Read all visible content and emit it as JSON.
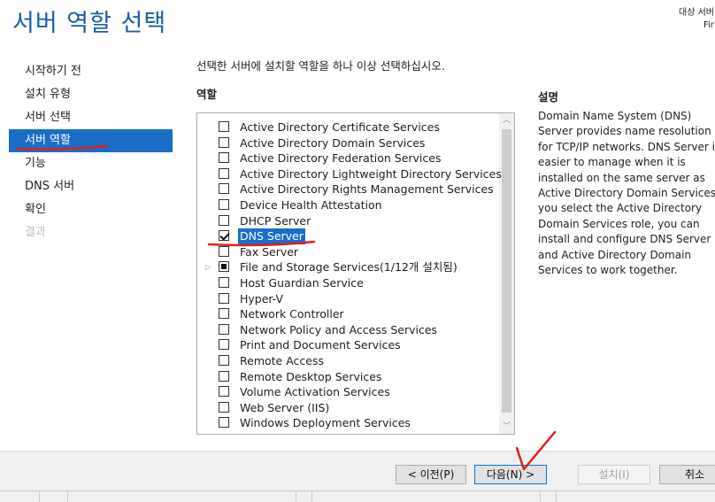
{
  "page": {
    "title": "서버 역할 선택",
    "target_server_label": "대상 서버",
    "target_server_name": "Fir"
  },
  "nav": {
    "items": [
      {
        "label": "시작하기 전",
        "state": "normal"
      },
      {
        "label": "설치 유형",
        "state": "normal"
      },
      {
        "label": "서버 선택",
        "state": "normal"
      },
      {
        "label": "서버 역할",
        "state": "active"
      },
      {
        "label": "기능",
        "state": "normal"
      },
      {
        "label": "DNS 서버",
        "state": "normal"
      },
      {
        "label": "확인",
        "state": "normal"
      },
      {
        "label": "결과",
        "state": "disabled"
      }
    ]
  },
  "main": {
    "instruction": "선택한 서버에 설치할 역할을 하나 이상 선택하십시오.",
    "roles_heading": "역할",
    "description_heading": "설명",
    "roles": [
      {
        "label": "Active Directory Certificate Services",
        "state": "unchecked",
        "selected": false,
        "expandable": false
      },
      {
        "label": "Active Directory Domain Services",
        "state": "unchecked",
        "selected": false,
        "expandable": false
      },
      {
        "label": "Active Directory Federation Services",
        "state": "unchecked",
        "selected": false,
        "expandable": false
      },
      {
        "label": "Active Directory Lightweight Directory Services",
        "state": "unchecked",
        "selected": false,
        "expandable": false
      },
      {
        "label": "Active Directory Rights Management Services",
        "state": "unchecked",
        "selected": false,
        "expandable": false
      },
      {
        "label": "Device Health Attestation",
        "state": "unchecked",
        "selected": false,
        "expandable": false
      },
      {
        "label": "DHCP Server",
        "state": "unchecked",
        "selected": false,
        "expandable": false
      },
      {
        "label": "DNS Server",
        "state": "checked",
        "selected": true,
        "expandable": false
      },
      {
        "label": "Fax Server",
        "state": "unchecked",
        "selected": false,
        "expandable": false
      },
      {
        "label": "File and Storage Services(1/12개 설치됨)",
        "state": "partial",
        "selected": false,
        "expandable": true
      },
      {
        "label": "Host Guardian Service",
        "state": "unchecked",
        "selected": false,
        "expandable": false
      },
      {
        "label": "Hyper-V",
        "state": "unchecked",
        "selected": false,
        "expandable": false
      },
      {
        "label": "Network Controller",
        "state": "unchecked",
        "selected": false,
        "expandable": false
      },
      {
        "label": "Network Policy and Access Services",
        "state": "unchecked",
        "selected": false,
        "expandable": false
      },
      {
        "label": "Print and Document Services",
        "state": "unchecked",
        "selected": false,
        "expandable": false
      },
      {
        "label": "Remote Access",
        "state": "unchecked",
        "selected": false,
        "expandable": false
      },
      {
        "label": "Remote Desktop Services",
        "state": "unchecked",
        "selected": false,
        "expandable": false
      },
      {
        "label": "Volume Activation Services",
        "state": "unchecked",
        "selected": false,
        "expandable": false
      },
      {
        "label": "Web Server (IIS)",
        "state": "unchecked",
        "selected": false,
        "expandable": false
      },
      {
        "label": "Windows Deployment Services",
        "state": "unchecked",
        "selected": false,
        "expandable": false
      }
    ],
    "description_lines": [
      "Domain Name System (DNS)",
      "Server provides name resolution",
      "for TCP/IP networks. DNS Server is",
      "easier to manage when it is",
      "installed on the same server as",
      "Active Directory Domain Services. If",
      "you select the Active Directory",
      "Domain Services role, you can",
      "install and configure DNS Server",
      "and Active Directory Domain",
      "Services to work together."
    ]
  },
  "footer": {
    "prev_label": "< 이전(P)",
    "next_label": "다음(N) >",
    "install_label": "설치(I)",
    "cancel_label": "취소"
  },
  "colors": {
    "accent": "#1a6ec7",
    "title": "#1a5ea8",
    "annotation": "#e0201c"
  }
}
